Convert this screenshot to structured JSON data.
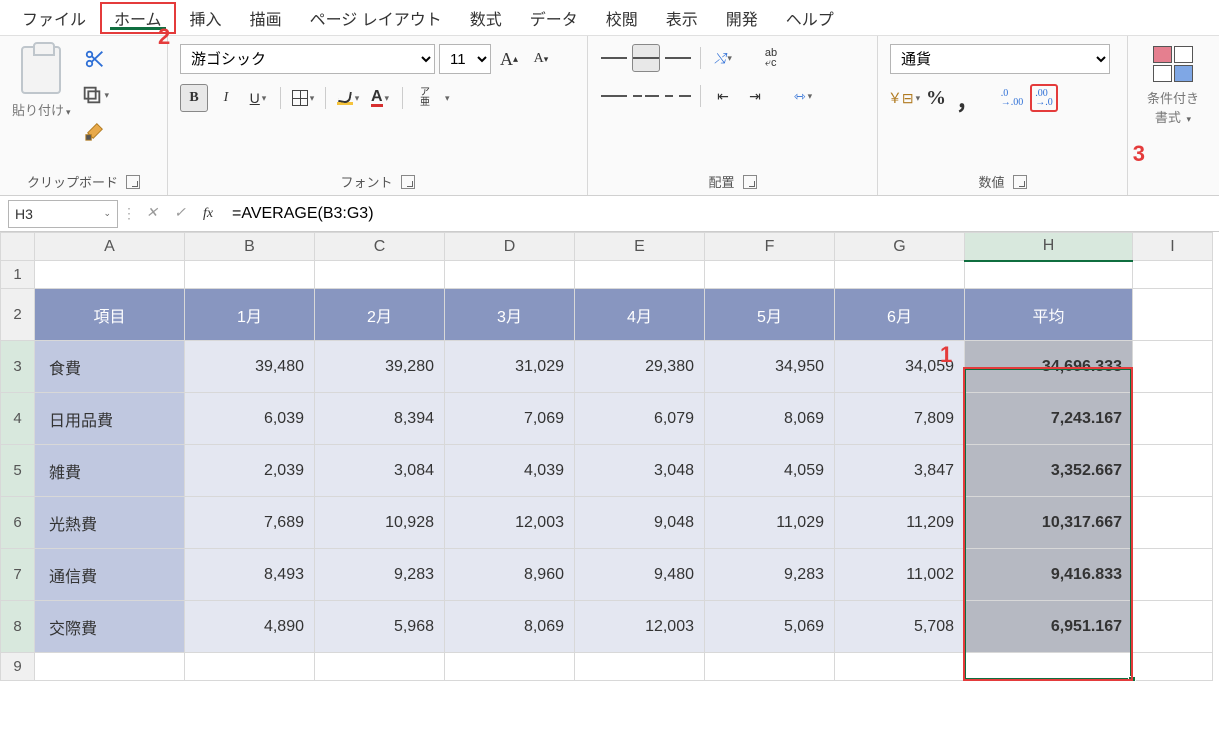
{
  "menu": {
    "file": "ファイル",
    "home": "ホーム",
    "insert": "挿入",
    "draw": "描画",
    "layout": "ページ レイアウト",
    "formula": "数式",
    "data": "データ",
    "review": "校閲",
    "view": "表示",
    "dev": "開発",
    "help": "ヘルプ"
  },
  "ribbon": {
    "clipboard": {
      "paste": "貼り付け",
      "label": "クリップボード"
    },
    "font": {
      "name": "游ゴシック",
      "size": "11",
      "label": "フォント",
      "bold": "B",
      "italic": "I",
      "underline": "U",
      "phonetic": "ア\n亜"
    },
    "align": {
      "label": "配置",
      "wrap": "ab"
    },
    "number": {
      "format": "通貨",
      "label": "数値",
      "pct": "%",
      "comma": "，",
      "dec_inc": ".00\n→.0",
      "dec_dec": ".0\n→.00"
    },
    "cf": {
      "label": "条件付き\n書式"
    }
  },
  "callouts": {
    "c1": "1",
    "c2": "2",
    "c3": "3"
  },
  "fbar": {
    "name": "H3",
    "formula": "=AVERAGE(B3:G3)",
    "fx": "fx"
  },
  "cols": [
    "A",
    "B",
    "C",
    "D",
    "E",
    "F",
    "G",
    "H",
    "I"
  ],
  "table": {
    "headers": [
      "項目",
      "1月",
      "2月",
      "3月",
      "4月",
      "5月",
      "6月",
      "平均"
    ],
    "rows": [
      {
        "label": "食費",
        "v": [
          "39,480",
          "39,280",
          "31,029",
          "29,380",
          "34,950",
          "34,059"
        ],
        "avg": "34,696.333"
      },
      {
        "label": "日用品費",
        "v": [
          "6,039",
          "8,394",
          "7,069",
          "6,079",
          "8,069",
          "7,809"
        ],
        "avg": "7,243.167"
      },
      {
        "label": "雑費",
        "v": [
          "2,039",
          "3,084",
          "4,039",
          "3,048",
          "4,059",
          "3,847"
        ],
        "avg": "3,352.667"
      },
      {
        "label": "光熱費",
        "v": [
          "7,689",
          "10,928",
          "12,003",
          "9,048",
          "11,029",
          "11,209"
        ],
        "avg": "10,317.667"
      },
      {
        "label": "通信費",
        "v": [
          "8,493",
          "9,283",
          "8,960",
          "9,480",
          "9,283",
          "11,002"
        ],
        "avg": "9,416.833"
      },
      {
        "label": "交際費",
        "v": [
          "4,890",
          "5,968",
          "8,069",
          "12,003",
          "5,069",
          "5,708"
        ],
        "avg": "6,951.167"
      }
    ]
  }
}
